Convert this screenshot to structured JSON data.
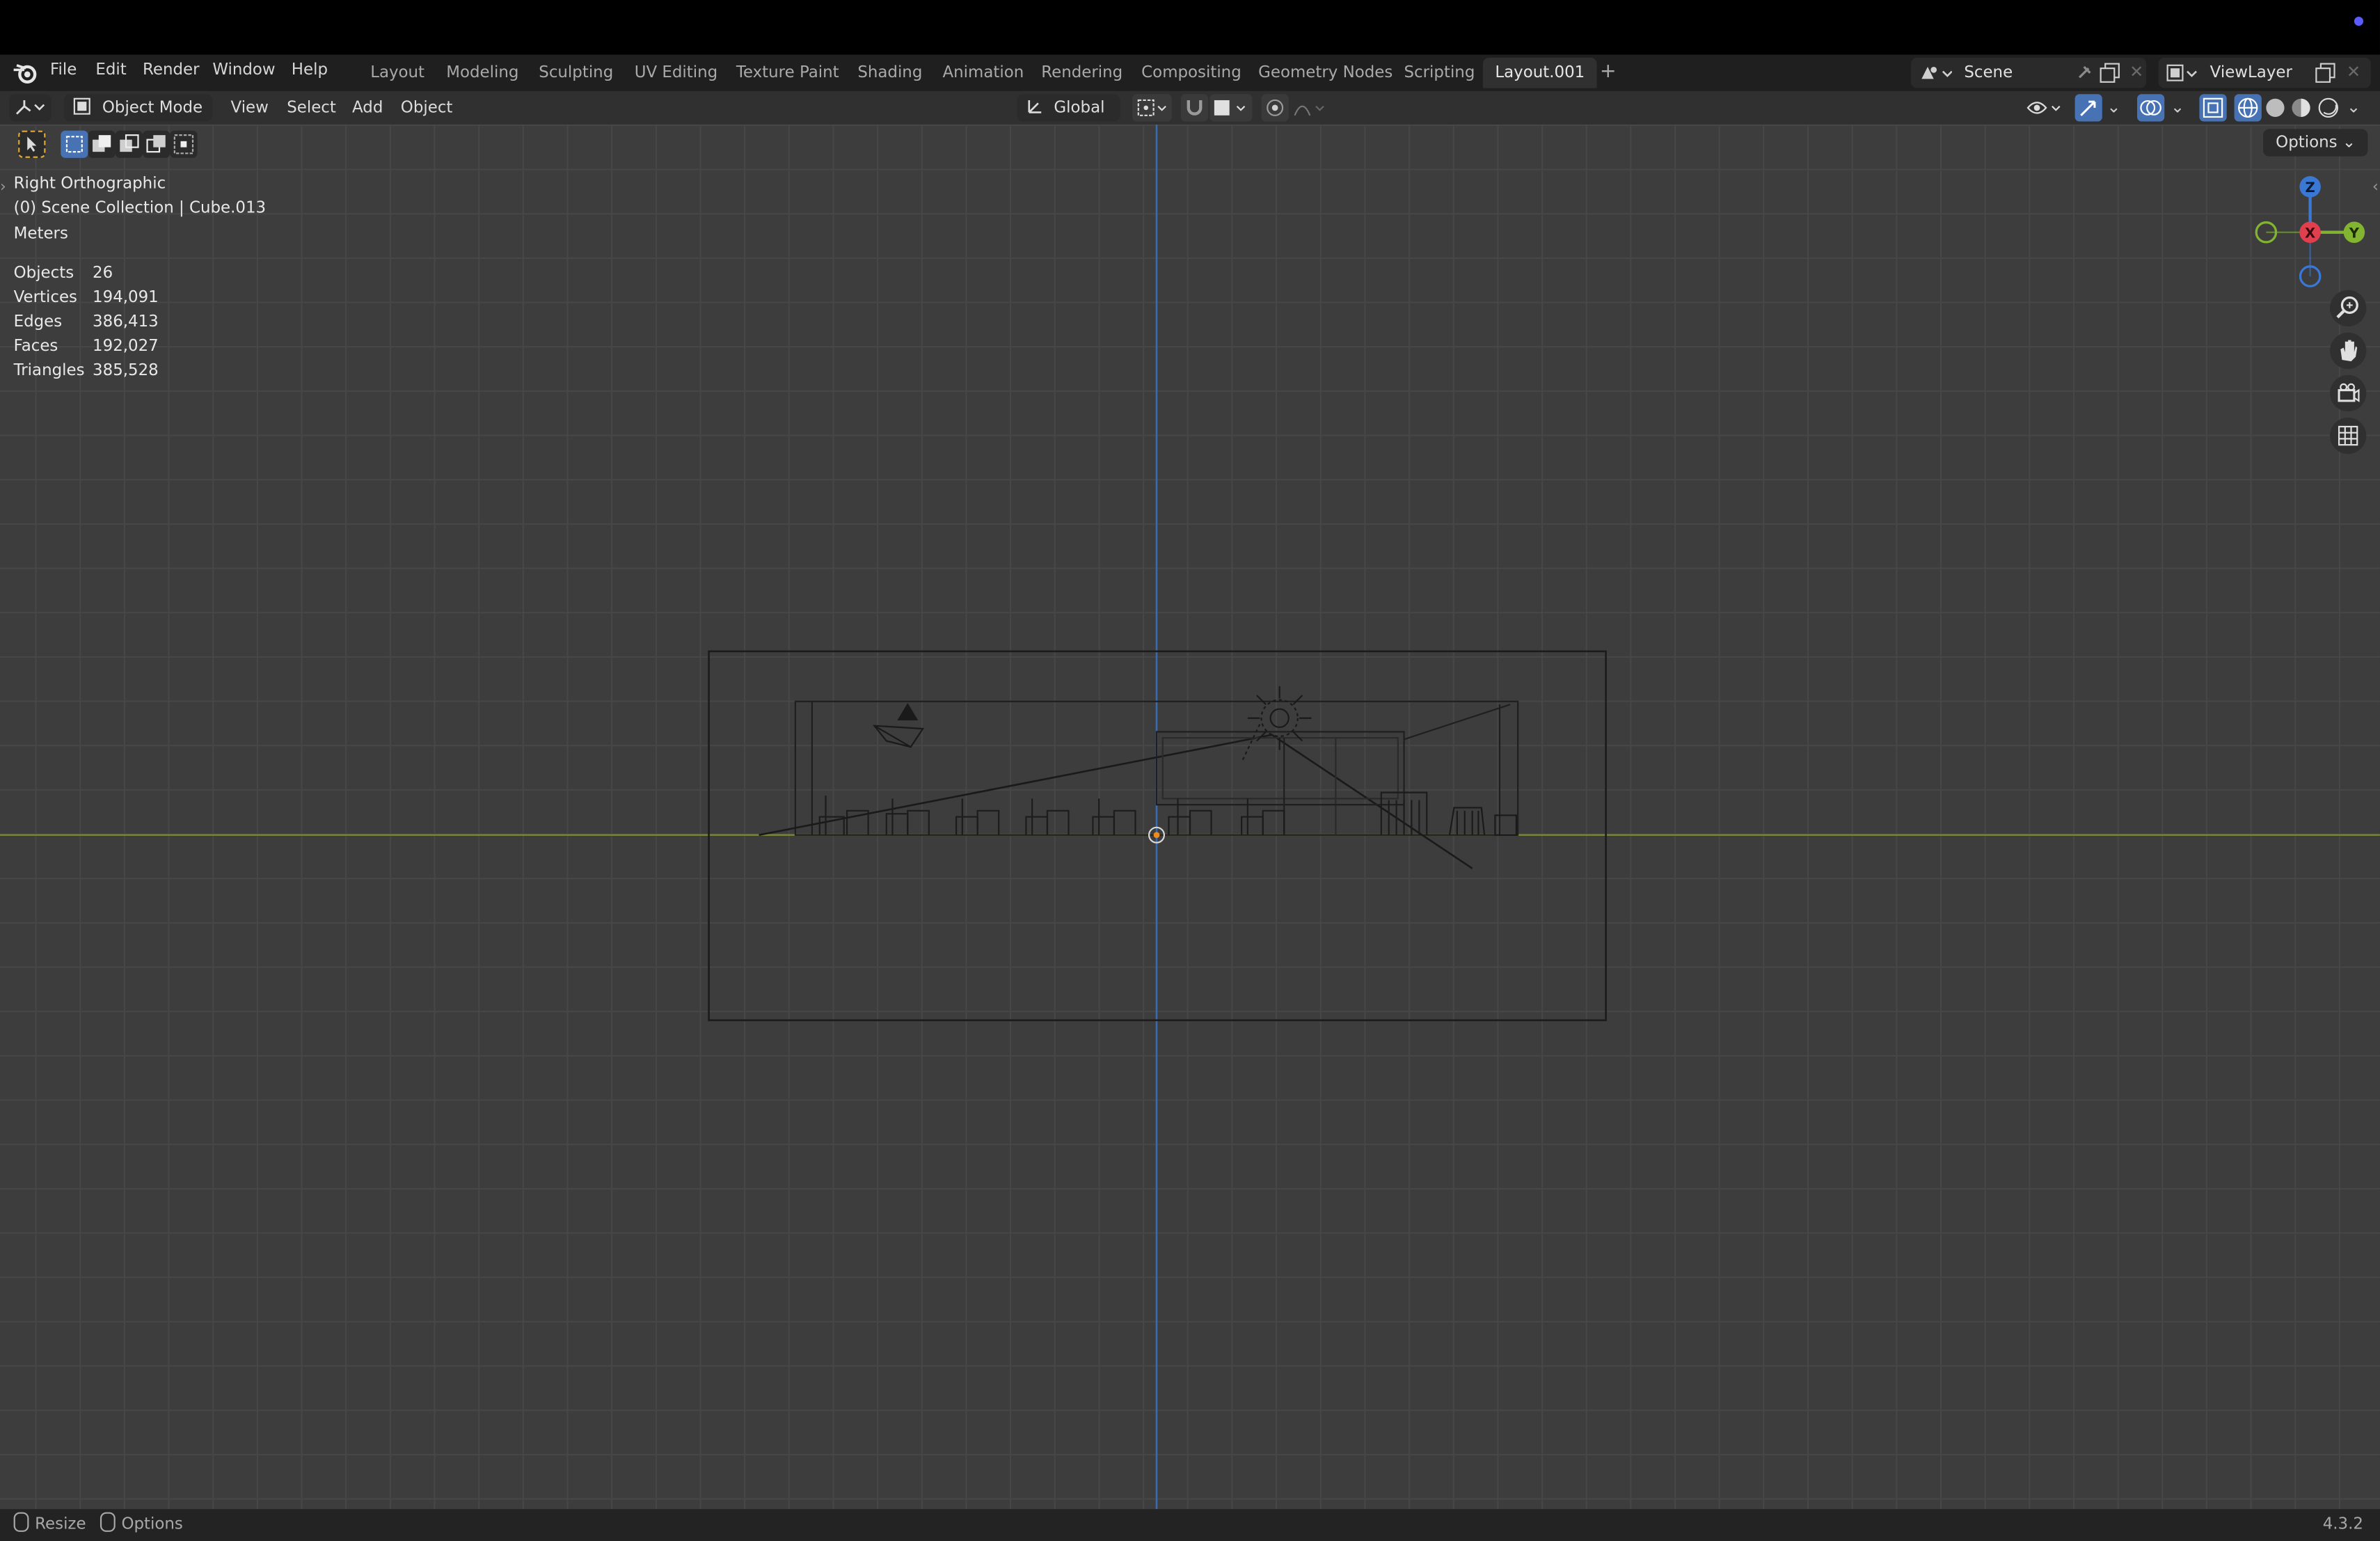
{
  "menu": {
    "items": [
      "File",
      "Edit",
      "Render",
      "Window",
      "Help"
    ]
  },
  "workspaces": {
    "tabs": [
      "Layout",
      "Modeling",
      "Sculpting",
      "UV Editing",
      "Texture Paint",
      "Shading",
      "Animation",
      "Rendering",
      "Compositing",
      "Geometry Nodes",
      "Scripting",
      "Layout.001"
    ],
    "active": "Layout.001",
    "add_symbol": "+"
  },
  "scene": {
    "name": "Scene"
  },
  "view_layer": {
    "name": "ViewLayer"
  },
  "header": {
    "mode": "Object Mode",
    "menus": [
      "View",
      "Select",
      "Add",
      "Object"
    ],
    "orientation": "Global"
  },
  "viewport": {
    "view_name": "Right Orthographic",
    "collection": "(0) Scene Collection | Cube.013",
    "units": "Meters",
    "options_label": "Options",
    "stats": [
      {
        "label": "Objects",
        "value": "26"
      },
      {
        "label": "Vertices",
        "value": "194,091"
      },
      {
        "label": "Edges",
        "value": "386,413"
      },
      {
        "label": "Faces",
        "value": "192,027"
      },
      {
        "label": "Triangles",
        "value": "385,528"
      }
    ],
    "gizmo": {
      "z": "Z",
      "x": "X",
      "y": "Y"
    }
  },
  "statusbar": {
    "resize": "Resize",
    "options": "Options",
    "version": "4.3.2"
  },
  "colors": {
    "accent_blue": "#4772b3",
    "axis_y_line": "#8a9a2b",
    "axis_z_line": "#3f6fb5",
    "gizmo_x": "#e0404d",
    "gizmo_y": "#82b431",
    "gizmo_z": "#3a78d4"
  }
}
